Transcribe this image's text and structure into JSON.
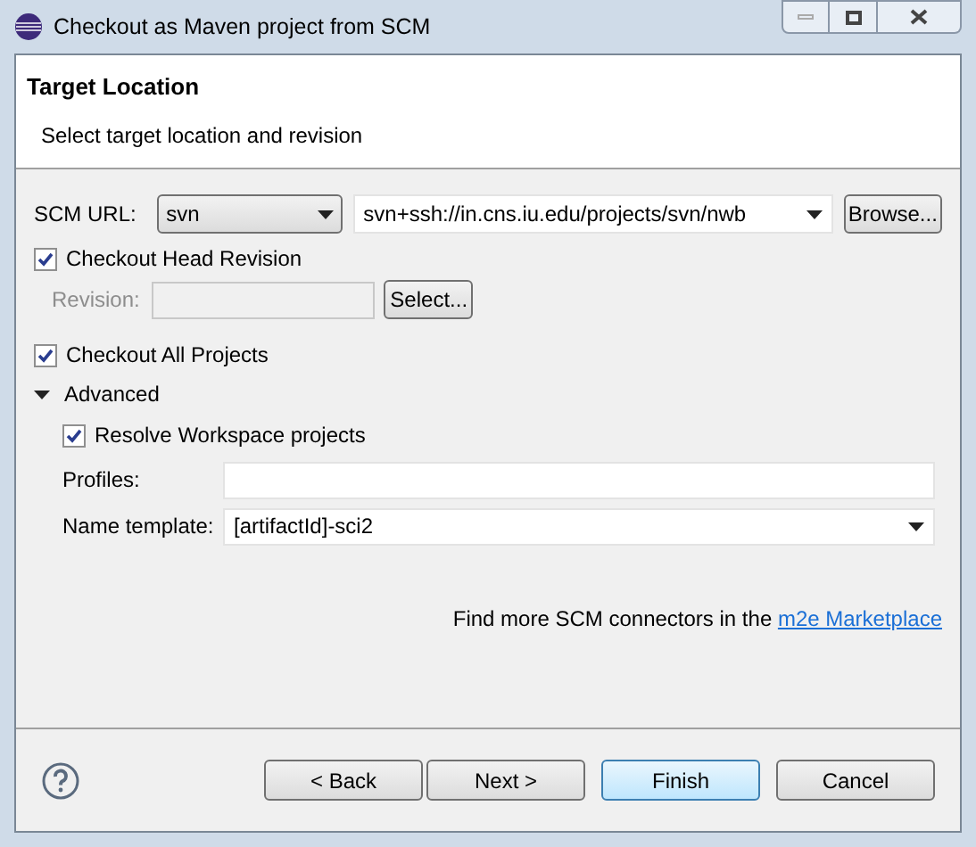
{
  "window": {
    "title": "Checkout as Maven project from SCM"
  },
  "header": {
    "title": "Target Location",
    "subtitle": "Select target location and revision"
  },
  "scm_url": {
    "label": "SCM URL:",
    "type": "svn",
    "url": "svn+ssh://in.cns.iu.edu/projects/svn/nwb",
    "browse": "Browse..."
  },
  "head_revision": {
    "label": "Checkout Head Revision",
    "checked": true
  },
  "revision": {
    "label": "Revision:",
    "disabled": true,
    "select": "Select..."
  },
  "all_projects": {
    "label": "Checkout All Projects",
    "checked": true
  },
  "advanced": {
    "label": "Advanced",
    "expanded": true,
    "resolve_workspace": {
      "label": "Resolve Workspace projects",
      "checked": true
    },
    "profiles": {
      "label": "Profiles:"
    },
    "name_template": {
      "label": "Name template:",
      "value": "[artifactId]-sci2"
    }
  },
  "marketplace": {
    "text": "Find more SCM connectors in the ",
    "link": "m2e Marketplace"
  },
  "buttons": [
    {
      "label": "< Back",
      "default": false
    },
    {
      "label": "Next >",
      "default": false
    },
    {
      "label": "Finish",
      "default": true
    },
    {
      "label": "Cancel",
      "default": false
    }
  ]
}
